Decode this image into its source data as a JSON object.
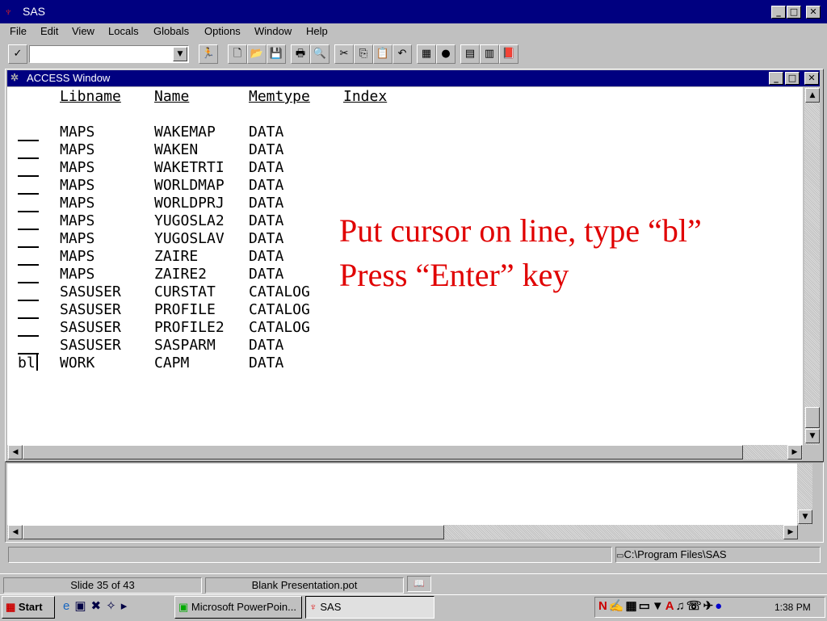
{
  "app": {
    "title": "SAS"
  },
  "menu": {
    "items": [
      "File",
      "Edit",
      "View",
      "Locals",
      "Globals",
      "Options",
      "Window",
      "Help"
    ]
  },
  "toolbar": {
    "command_value": ""
  },
  "access_window": {
    "title": "ACCESS Window",
    "headers": {
      "libname": "Libname",
      "name": "Name",
      "memtype": "Memtype",
      "index": "Index"
    },
    "rows": [
      {
        "cmd": "",
        "libname": "MAPS",
        "name": "WAKEMAP",
        "memtype": "DATA"
      },
      {
        "cmd": "",
        "libname": "MAPS",
        "name": "WAKEN",
        "memtype": "DATA"
      },
      {
        "cmd": "",
        "libname": "MAPS",
        "name": "WAKETRTI",
        "memtype": "DATA"
      },
      {
        "cmd": "",
        "libname": "MAPS",
        "name": "WORLDMAP",
        "memtype": "DATA"
      },
      {
        "cmd": "",
        "libname": "MAPS",
        "name": "WORLDPRJ",
        "memtype": "DATA"
      },
      {
        "cmd": "",
        "libname": "MAPS",
        "name": "YUGOSLA2",
        "memtype": "DATA"
      },
      {
        "cmd": "",
        "libname": "MAPS",
        "name": "YUGOSLAV",
        "memtype": "DATA"
      },
      {
        "cmd": "",
        "libname": "MAPS",
        "name": "ZAIRE",
        "memtype": "DATA"
      },
      {
        "cmd": "",
        "libname": "MAPS",
        "name": "ZAIRE2",
        "memtype": "DATA"
      },
      {
        "cmd": "",
        "libname": "SASUSER",
        "name": "CURSTAT",
        "memtype": "CATALOG"
      },
      {
        "cmd": "",
        "libname": "SASUSER",
        "name": "PROFILE",
        "memtype": "CATALOG"
      },
      {
        "cmd": "",
        "libname": "SASUSER",
        "name": "PROFILE2",
        "memtype": "CATALOG"
      },
      {
        "cmd": "",
        "libname": "SASUSER",
        "name": "SASPARM",
        "memtype": "DATA"
      },
      {
        "cmd": "bl",
        "libname": "WORK",
        "name": "CAPM",
        "memtype": "DATA"
      }
    ]
  },
  "annotation": {
    "line1": "Put cursor on line, type “bl”",
    "line2": "Press “Enter” key"
  },
  "status": {
    "path": "C:\\Program Files\\SAS"
  },
  "ppt_status": {
    "slide": "Slide 35 of 43",
    "design": "Blank Presentation.pot"
  },
  "taskbar": {
    "start": "Start",
    "tasks": [
      "Microsoft PowerPoin...",
      "SAS"
    ],
    "clock": "1:38 PM"
  },
  "colors": {
    "titlebar": "#000080",
    "annotation": "#e00000",
    "face": "#c0c0c0"
  }
}
